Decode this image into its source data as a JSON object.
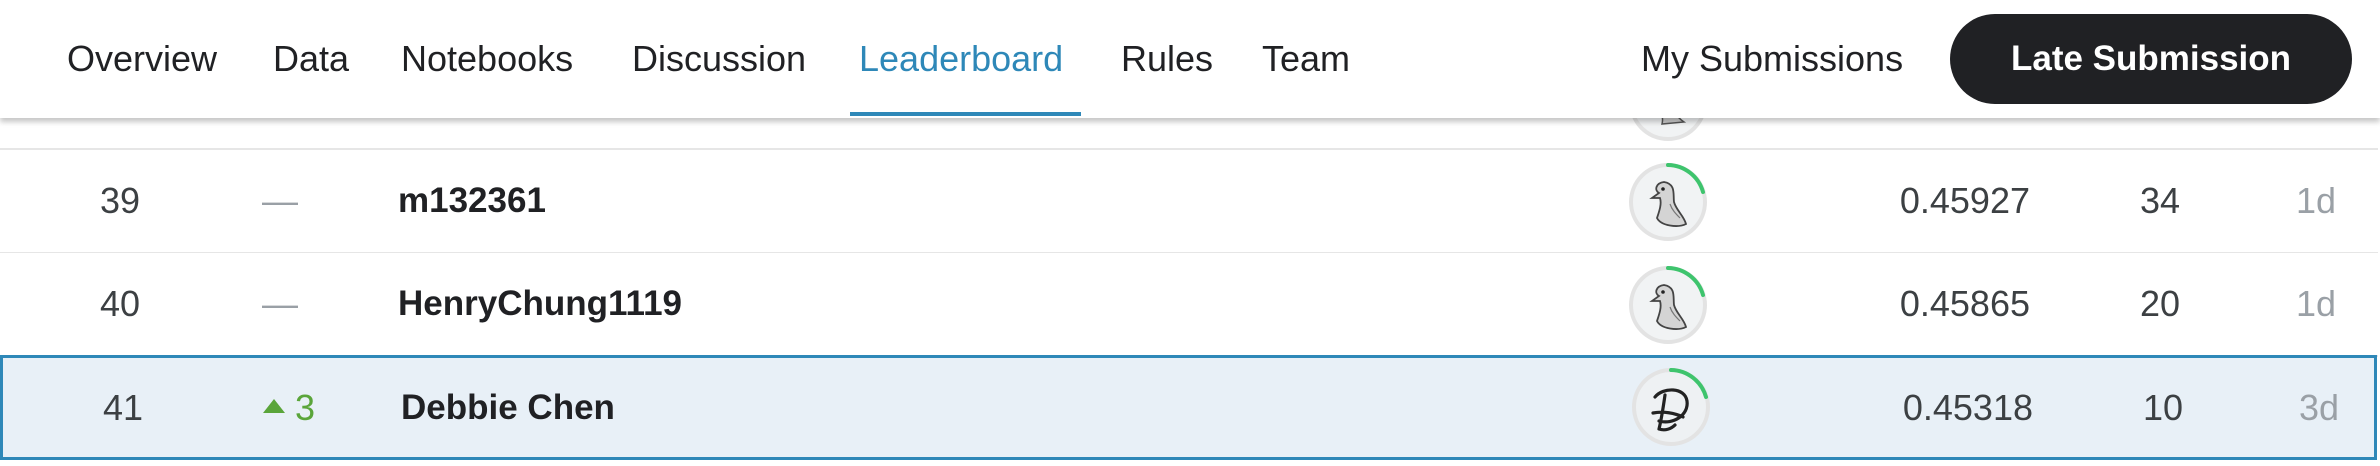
{
  "nav": {
    "tabs": [
      {
        "label": "Overview"
      },
      {
        "label": "Data"
      },
      {
        "label": "Notebooks"
      },
      {
        "label": "Discussion"
      },
      {
        "label": "Leaderboard",
        "active": true
      },
      {
        "label": "Rules"
      },
      {
        "label": "Team"
      }
    ],
    "my_submissions": "My Submissions",
    "late_submission": "Late Submission"
  },
  "leaderboard": {
    "rows": [
      {
        "rank": "39",
        "delta": "—",
        "team": "m132361",
        "score": "0.45927",
        "entries": "34",
        "last": "1d",
        "avatar": "kaggle-goose-avatar"
      },
      {
        "rank": "40",
        "delta": "—",
        "team": "HenryChung1119",
        "score": "0.45865",
        "entries": "20",
        "last": "1d",
        "avatar": "kaggle-goose-avatar"
      },
      {
        "rank": "41",
        "delta": "3",
        "delta_direction": "up",
        "team": "Debbie Chen",
        "score": "0.45318",
        "entries": "10",
        "last": "3d",
        "avatar": "initials-D-avatar",
        "highlighted": true
      }
    ]
  },
  "colors": {
    "accent": "#2e88b8",
    "highlight_bg": "#e8f0f7",
    "up": "#5aa53a",
    "tier_ring": "#3ec46d",
    "button_bg": "#202124"
  }
}
